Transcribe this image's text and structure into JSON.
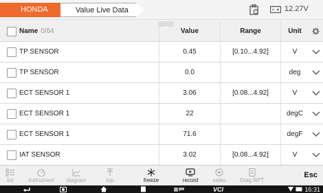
{
  "tabs": {
    "brand": "HONDA",
    "current": "Value Live Data"
  },
  "status": {
    "voltage": "12.27V"
  },
  "table": {
    "headers": {
      "name": "Name",
      "count": "0/64",
      "value": "Value",
      "range": "Range",
      "unit": "Unit"
    },
    "rows": [
      {
        "name": "TP SENSOR",
        "value": "0.45",
        "range": "[0.10...4.92]",
        "unit": "V"
      },
      {
        "name": "TP SENSOR",
        "value": "0.0",
        "range": "",
        "unit": "deg"
      },
      {
        "name": "ECT SENSOR 1",
        "value": "3.06",
        "range": "[0.08...4.92]",
        "unit": "V"
      },
      {
        "name": "ECT SENSOR 1",
        "value": "22",
        "range": "",
        "unit": "degC"
      },
      {
        "name": "ECT SENSOR 1",
        "value": "71.6",
        "range": "",
        "unit": "degF"
      },
      {
        "name": "IAT SENSOR",
        "value": "3.02",
        "range": "[0.08...4.92]",
        "unit": "V"
      }
    ]
  },
  "toolbar": {
    "list": "list",
    "instrument": "instrument",
    "diagram": "diagram",
    "top": "top",
    "freeze": "freeze",
    "record": "record",
    "video": "video",
    "diag_rpt": "Diag RPT",
    "esc": "Esc"
  },
  "navbar": {
    "vci": "VCI",
    "time": "16:31"
  }
}
